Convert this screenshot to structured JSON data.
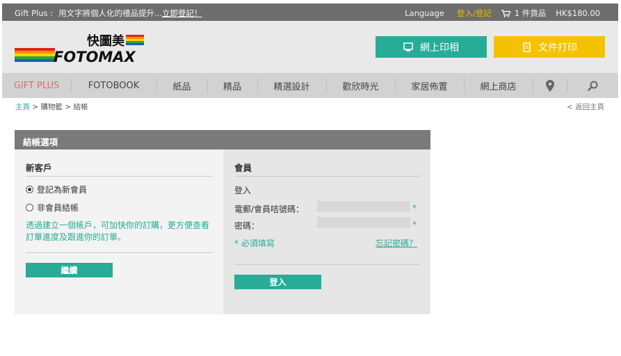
{
  "topbar": {
    "brand": "Gift Plus :",
    "promo_text": "用文字將個人化的禮品提升...",
    "register_link": "立即登記！",
    "language": "Language",
    "login": "登入/登記",
    "cart_count": "1 件貨品",
    "cart_total": "HK$180.00"
  },
  "header": {
    "logo_text_cn": "快圖美",
    "logo_text_en": "FOTOMAX",
    "photo_button": "網上印相",
    "print_button": "文件打印"
  },
  "nav": {
    "items": [
      {
        "label": "GIFT PLUS"
      },
      {
        "label": "FOTOBOOK"
      },
      {
        "label": "紙品"
      },
      {
        "label": "精品"
      },
      {
        "label": "精選設計"
      },
      {
        "label": "歡欣時光"
      },
      {
        "label": "家居佈置"
      },
      {
        "label": "網上商店"
      }
    ]
  },
  "breadcrumb": {
    "home": "主頁",
    "sep": ">",
    "cart": "購物籃",
    "checkout": "結帳",
    "back": "< 返回主頁"
  },
  "panel": {
    "title": "結帳選項",
    "new_customer": {
      "title": "新客戶",
      "option_register": "登記為新會員",
      "option_guest": "非會員結帳",
      "selected": "register",
      "description": "透過建立一個帳戶，可加快你的訂購，更方便查看訂單進度及跟進你的訂單。",
      "continue_button": "繼續"
    },
    "member": {
      "title": "會員",
      "login_heading": "登入",
      "email_label": "電郵/會員咭號碼：",
      "password_label": "密碼：",
      "required_mark": "*",
      "required_note": "* 必須填寫",
      "forgot_password": "忘記密碼？",
      "login_button": "登入"
    }
  },
  "colors": {
    "teal": "#26ac97",
    "yellow": "#f4c200",
    "topbar": "#6d6d6d",
    "active_nav": "#e06b70"
  }
}
